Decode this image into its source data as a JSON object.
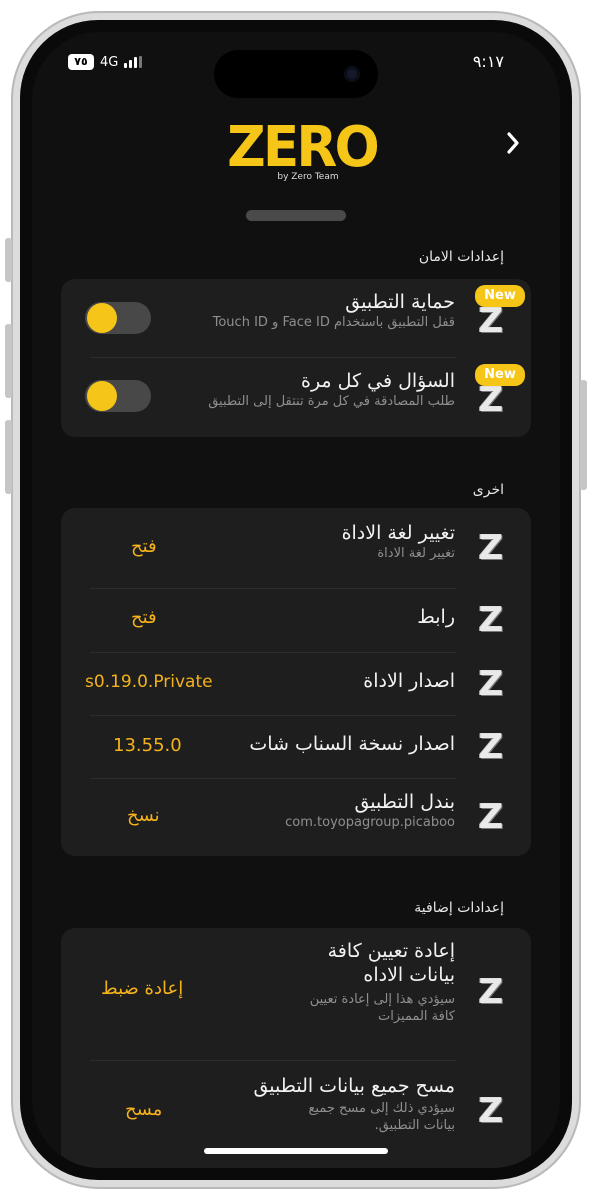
{
  "status_bar": {
    "battery": "٧٥",
    "network": "4G",
    "time": "٩:١٧"
  },
  "header": {
    "logo_text": "ZERO",
    "logo_subtitle": "by Zero Team",
    "back_icon": "chevron-right-icon"
  },
  "sections": {
    "security": {
      "title": "إعدادات الامان",
      "rows": [
        {
          "title": "حماية التطبيق",
          "subtitle": "قفل التطبيق باستخدام Face ID و Touch ID",
          "badge": "New",
          "toggle_on": true
        },
        {
          "title": "السؤال في كل مرة",
          "subtitle": "طلب المصادقة في كل مرة تنتقل إلى التطبيق",
          "badge": "New",
          "toggle_on": true
        }
      ]
    },
    "other": {
      "title": "اخرى",
      "rows": [
        {
          "title": "تغيير لغة الاداة",
          "subtitle": "تغيير لغة الاداة",
          "action": "فتح"
        },
        {
          "title": "رابط",
          "subtitle": "",
          "action": "فتح"
        },
        {
          "title": "اصدار الاداة",
          "subtitle": "",
          "value": "s0.19.0.Private"
        },
        {
          "title": "اصدار نسخة السناب شات",
          "subtitle": "",
          "value": "13.55.0"
        },
        {
          "title": "بندل التطبيق",
          "subtitle": "com.toyopagroup.picaboo",
          "action": "نسخ"
        }
      ]
    },
    "additional": {
      "title": "إعدادات إضافية",
      "rows": [
        {
          "title_line1": "إعادة تعيين كافة",
          "title_line2": "بيانات الاداه",
          "subtitle_line1": "سيؤدي هذا إلى إعادة تعيين",
          "subtitle_line2": "كافة المميزات",
          "action": "إعادة ضبط"
        },
        {
          "title_line1": "مسح جميع بيانات التطبيق",
          "subtitle_line1": "سيؤدي ذلك إلى مسح جميع",
          "subtitle_line2": "بيانات التطبيق.",
          "action": "مسح"
        }
      ]
    }
  },
  "icons": {
    "row_icon": "z-logo-icon",
    "z_glyph": "Z"
  },
  "colors": {
    "accent": "#f5c518",
    "action": "#f5b21b",
    "background": "#101010",
    "card": "#1e1e1e"
  }
}
